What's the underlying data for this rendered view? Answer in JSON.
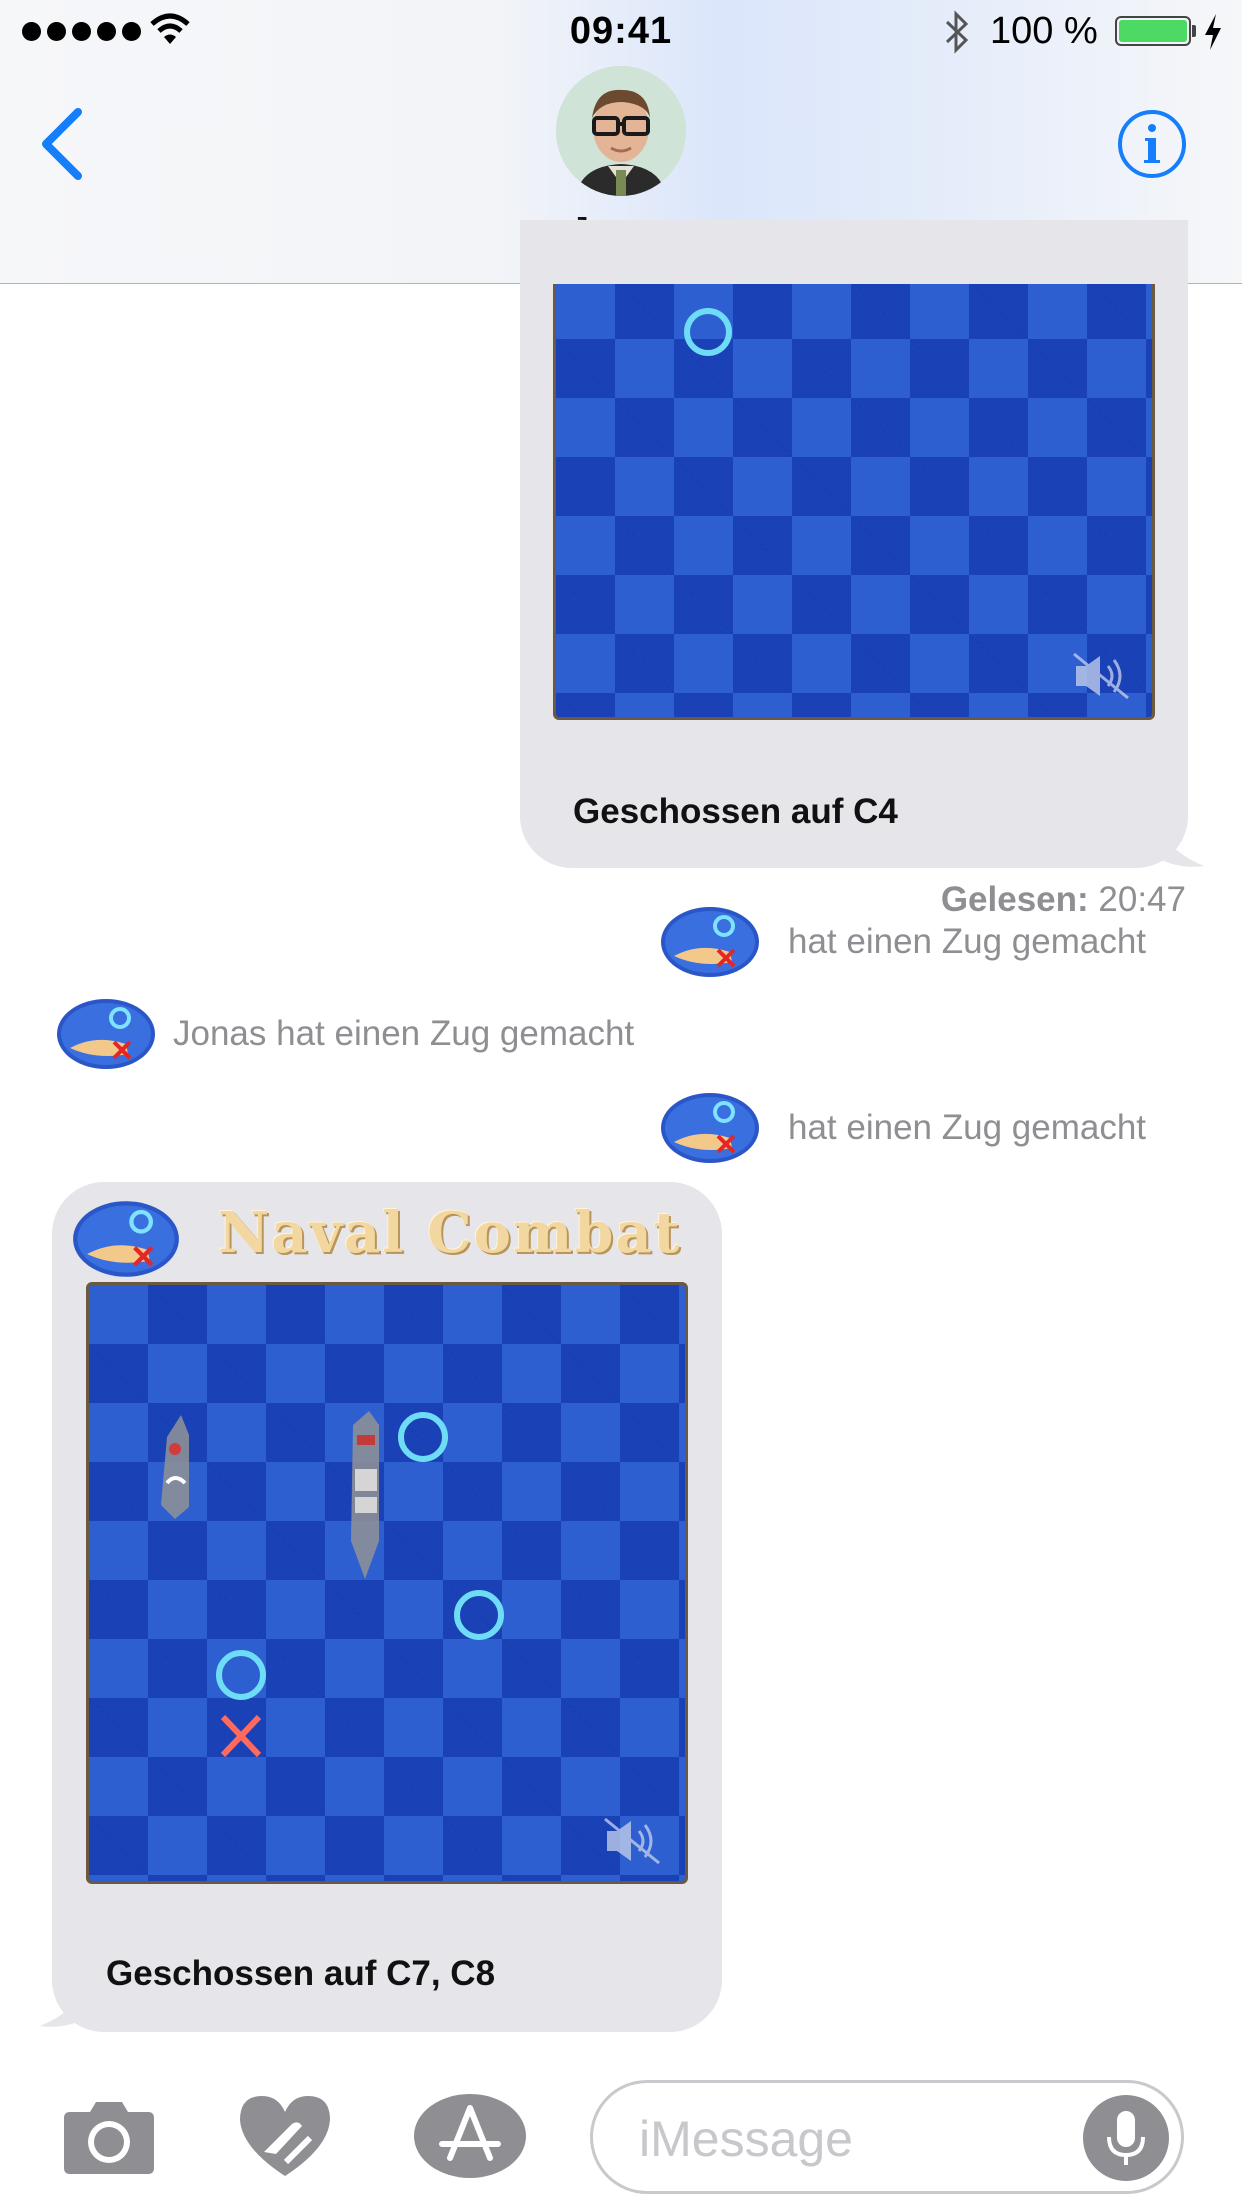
{
  "status_bar": {
    "time": "09:41",
    "battery_percent": "100 %",
    "battery_level": 1.0,
    "signal_bars": 5
  },
  "header": {
    "contact_name": "Jonas",
    "back_icon": "chevron-left-icon",
    "info_icon": "info-icon"
  },
  "messages": {
    "sent_game": {
      "caption": "Geschossen auf C4",
      "sound_icon": "sound-muted-icon"
    },
    "read_receipt": {
      "label": "Gelesen:",
      "time": "20:47"
    },
    "event_1": "hat einen Zug gemacht",
    "event_2": "Jonas hat einen Zug gemacht",
    "event_3": "hat einen Zug gemacht",
    "received_game": {
      "logo_text": "Naval Combat",
      "caption": "Geschossen auf C7, C8",
      "sound_icon": "sound-muted-icon"
    }
  },
  "input_bar": {
    "placeholder": "iMessage",
    "camera_icon": "camera-icon",
    "digital_touch_icon": "heart-touch-icon",
    "app_store_icon": "app-store-icon",
    "mic_icon": "microphone-icon"
  },
  "colors": {
    "accent": "#147efb",
    "bubble_gray": "#e5e5ea",
    "board_blue": "#2d5fd0",
    "meta_gray": "#8e8e93"
  }
}
